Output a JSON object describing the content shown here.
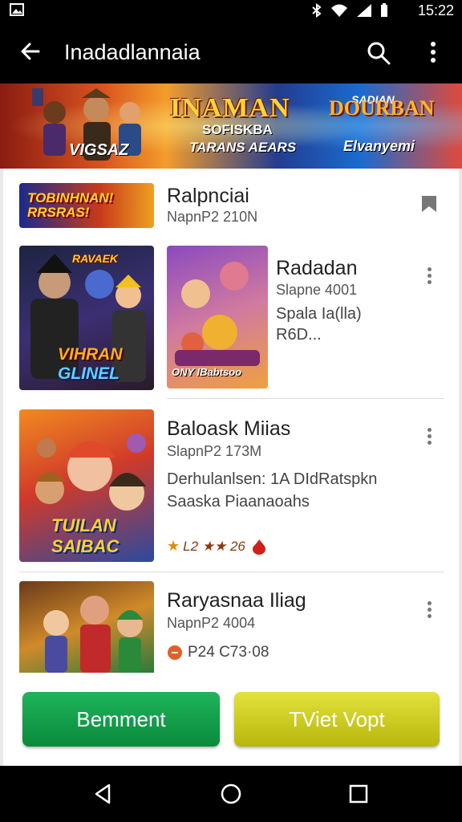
{
  "status": {
    "time": "15:22"
  },
  "appbar": {
    "title": "Inadadlannaia"
  },
  "banner": {
    "left_text": "VIGSAZ",
    "main_title": "INAMAN",
    "sub1": "SOFISKBA",
    "sub2": "TARANS AEARS",
    "right_top": "SADIAN",
    "right_logo": "DOURBAN",
    "right_sub": "Elvanyemi"
  },
  "featured": {
    "thumb_text": "TOBINHNAN! RRSRAS!",
    "title": "Ralpnciai",
    "subtitle": "NapnP2 210N"
  },
  "items": [
    {
      "poster_top": "RAVAEK",
      "poster_text_1": "VIHRAN",
      "poster_text_2": "GLINEL",
      "thumb_text": "ONY IBabtsoo",
      "title": "Radadan",
      "subtitle": "Slapne 4001",
      "desc_1": "Spala Ia(lla)",
      "desc_2": "R6D..."
    },
    {
      "thumb_text_1": "TUILAN",
      "thumb_text_2": "SAIBAC",
      "title": "Baloask Miias",
      "subtitle": "SlapnP2 173M",
      "desc_1": "Derhulanlsen: 1A DIdRatspkn",
      "desc_2": "Saaska Piaanaoahs",
      "rating_text": "L2 ★★ 26"
    },
    {
      "title": "Raryasnaa Iliag",
      "subtitle": "NapnP2 4004",
      "price_text": "P24 C73·08"
    }
  ],
  "buttons": {
    "primary": "Bemment",
    "secondary": "TViet Vopt"
  },
  "colors": {
    "green": "#0f9a46",
    "yellow": "#cfcf22",
    "bar": "#000000"
  }
}
